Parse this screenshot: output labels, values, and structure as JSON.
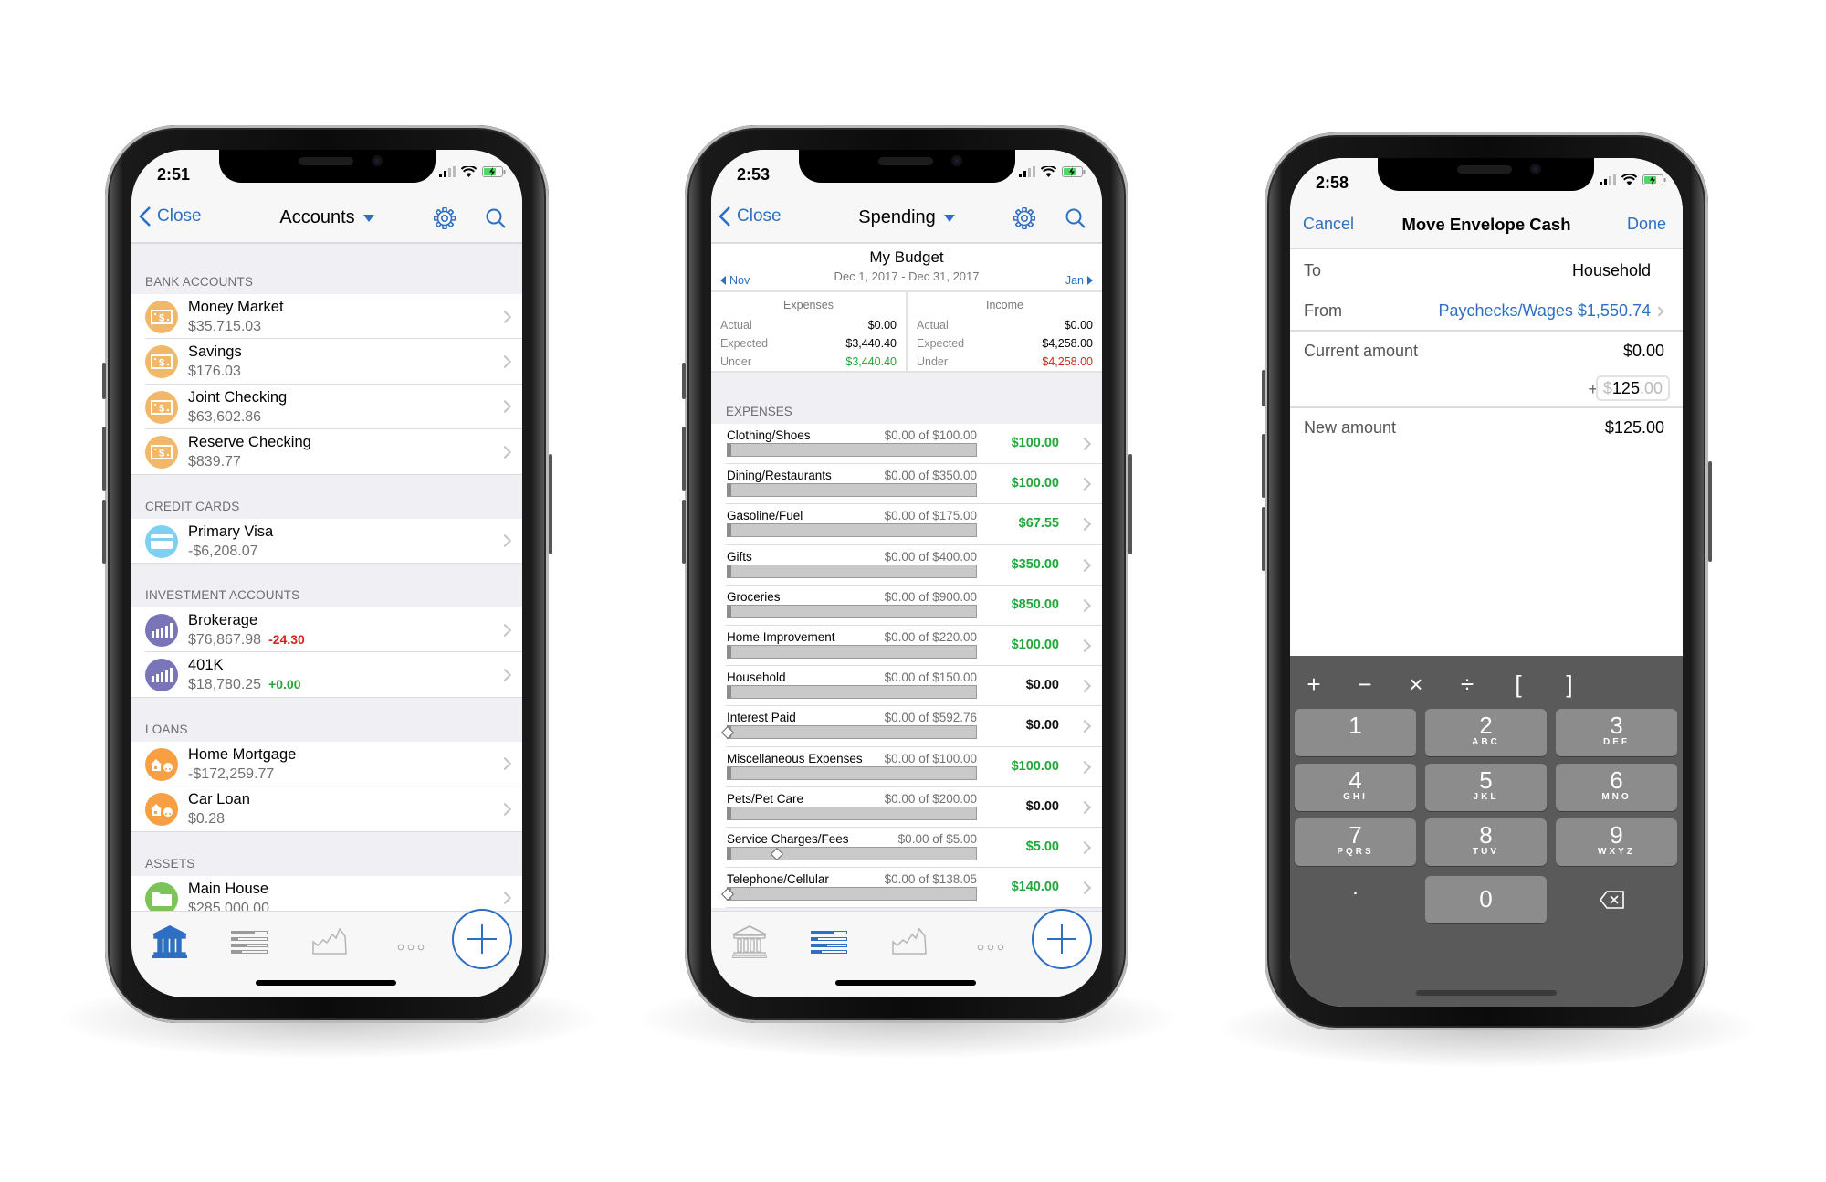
{
  "colors": {
    "accent": "#2e6fc2",
    "green": "#21a83a",
    "red": "#d0281f",
    "bank_icon": "#f1b869",
    "credit_icon": "#7fcff0",
    "invest_icon": "#7a74b8",
    "loan_icon": "#f6a043",
    "asset_icon": "#7cc35a",
    "keyboard": "#5a5a5a"
  },
  "accounts_screen": {
    "status_time": "2:51",
    "nav": {
      "back_label": "Close",
      "title": "Accounts",
      "icons": [
        "gear-icon",
        "search-icon"
      ]
    },
    "sections": [
      {
        "header": "BANK ACCOUNTS",
        "items": [
          {
            "name": "Money Market",
            "balance": "$35,715.03",
            "icon": "money"
          },
          {
            "name": "Savings",
            "balance": "$176.03",
            "icon": "money"
          },
          {
            "name": "Joint Checking",
            "balance": "$63,602.86",
            "icon": "money"
          },
          {
            "name": "Reserve Checking",
            "balance": "$839.77",
            "icon": "money"
          }
        ]
      },
      {
        "header": "CREDIT CARDS",
        "items": [
          {
            "name": "Primary Visa",
            "balance": "-$6,208.07",
            "icon": "credit"
          }
        ]
      },
      {
        "header": "INVESTMENT ACCOUNTS",
        "items": [
          {
            "name": "Brokerage",
            "balance": "$76,867.98",
            "change": "-24.30",
            "change_color": "red",
            "icon": "invest"
          },
          {
            "name": "401K",
            "balance": "$18,780.25",
            "change": "+0.00",
            "change_color": "green",
            "icon": "invest"
          }
        ]
      },
      {
        "header": "LOANS",
        "items": [
          {
            "name": "Home Mortgage",
            "balance": "-$172,259.77",
            "icon": "loan"
          },
          {
            "name": "Car Loan",
            "balance": "$0.28",
            "icon": "loan"
          }
        ]
      },
      {
        "header": "ASSETS",
        "items": [
          {
            "name": "Main House",
            "balance": "$285,000.00",
            "icon": "asset"
          }
        ]
      }
    ],
    "tabbar": {
      "active": "accounts",
      "tabs": [
        "accounts",
        "budget",
        "reports",
        "more"
      ]
    }
  },
  "spending_screen": {
    "status_time": "2:53",
    "nav": {
      "back_label": "Close",
      "title": "Spending"
    },
    "budget": {
      "title": "My Budget",
      "date_range": "Dec 1, 2017 - Dec 31, 2017",
      "prev": "Nov",
      "next": "Jan"
    },
    "summary": [
      {
        "label": "Expenses",
        "rows": [
          {
            "k": "Actual",
            "v": "$0.00"
          },
          {
            "k": "Expected",
            "v": "$3,440.40"
          },
          {
            "k": "Under",
            "v": "$3,440.40",
            "color": "green"
          }
        ]
      },
      {
        "label": "Income",
        "rows": [
          {
            "k": "Actual",
            "v": "$0.00"
          },
          {
            "k": "Expected",
            "v": "$4,258.00"
          },
          {
            "k": "Under",
            "v": "$4,258.00",
            "color": "red"
          }
        ]
      }
    ],
    "expenses_header": "EXPENSES",
    "expenses": [
      {
        "name": "Clothing/Shoes",
        "progress": "$0.00 of $100.00",
        "remaining": "$100.00",
        "color": "green"
      },
      {
        "name": "Dining/Restaurants",
        "progress": "$0.00 of $350.00",
        "remaining": "$100.00",
        "color": "green"
      },
      {
        "name": "Gasoline/Fuel",
        "progress": "$0.00 of $175.00",
        "remaining": "$67.55",
        "color": "green"
      },
      {
        "name": "Gifts",
        "progress": "$0.00 of $400.00",
        "remaining": "$350.00",
        "color": "green"
      },
      {
        "name": "Groceries",
        "progress": "$0.00 of $900.00",
        "remaining": "$850.00",
        "color": "green"
      },
      {
        "name": "Home Improvement",
        "progress": "$0.00 of $220.00",
        "remaining": "$100.00",
        "color": "green"
      },
      {
        "name": "Household",
        "progress": "$0.00 of $150.00",
        "remaining": "$0.00",
        "color": "black"
      },
      {
        "name": "Interest Paid",
        "progress": "$0.00 of $592.76",
        "remaining": "$0.00",
        "color": "black",
        "expected_marker": 0
      },
      {
        "name": "Miscellaneous Expenses",
        "progress": "$0.00 of $100.00",
        "remaining": "$100.00",
        "color": "green"
      },
      {
        "name": "Pets/Pet Care",
        "progress": "$0.00 of $200.00",
        "remaining": "$0.00",
        "color": "black"
      },
      {
        "name": "Service Charges/Fees",
        "progress": "$0.00 of $5.00",
        "remaining": "$5.00",
        "color": "green",
        "expected_marker": 0.2
      },
      {
        "name": "Telephone/Cellular",
        "progress": "$0.00 of $138.05",
        "remaining": "$140.00",
        "color": "green",
        "expected_marker": 0
      }
    ],
    "tabbar": {
      "active": "budget"
    }
  },
  "move_screen": {
    "status_time": "2:58",
    "nav": {
      "cancel": "Cancel",
      "title": "Move Envelope Cash",
      "done": "Done"
    },
    "to_label": "To",
    "to_value": "Household",
    "from_label": "From",
    "from_value": "Paychecks/Wages $1,550.74",
    "current_label": "Current amount",
    "current_value": "$0.00",
    "plus": "+",
    "input": {
      "prefix": "$",
      "whole": "125",
      "decimal": ".00"
    },
    "new_label": "New amount",
    "new_value": "$125.00",
    "keyboard": {
      "operators": [
        "+",
        "−",
        "×",
        "÷",
        "[",
        "]"
      ],
      "keys": [
        {
          "d": "1",
          "l": ""
        },
        {
          "d": "2",
          "l": "ABC"
        },
        {
          "d": "3",
          "l": "DEF"
        },
        {
          "d": "4",
          "l": "GHI"
        },
        {
          "d": "5",
          "l": "JKL"
        },
        {
          "d": "6",
          "l": "MNO"
        },
        {
          "d": "7",
          "l": "PQRS"
        },
        {
          "d": "8",
          "l": "TUV"
        },
        {
          "d": "9",
          "l": "WXYZ"
        }
      ],
      "dot": ".",
      "zero": "0",
      "backspace": "backspace-icon"
    }
  }
}
